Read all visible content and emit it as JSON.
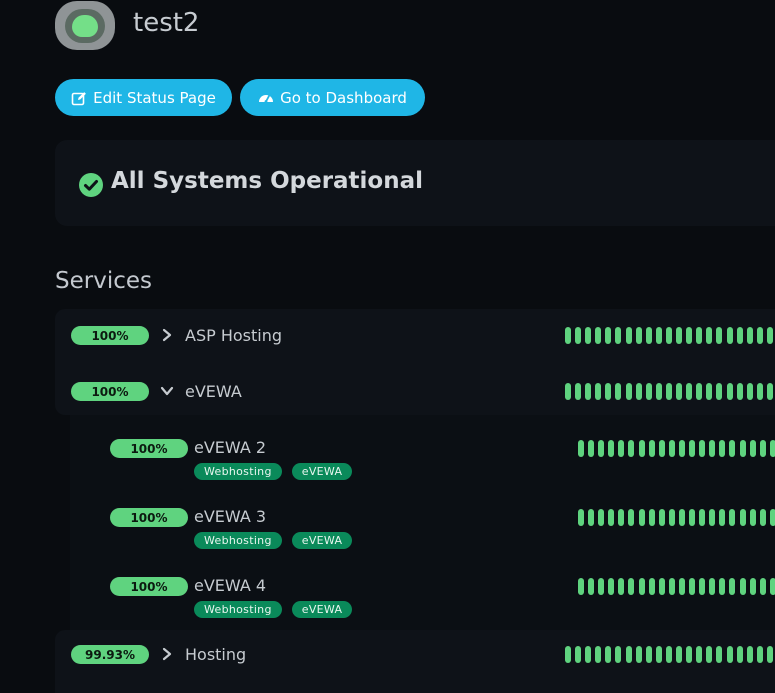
{
  "header": {
    "title": "test2"
  },
  "toolbar": {
    "edit_label": "Edit Status Page",
    "dashboard_label": "Go to Dashboard"
  },
  "overall": {
    "text": "All Systems Operational"
  },
  "services": {
    "title": "Services",
    "groups": [
      {
        "name": "ASP Hosting",
        "uptime": "100%"
      },
      {
        "name": "eVEWA",
        "uptime": "100%"
      },
      {
        "name": "Hosting",
        "uptime": "99.93%"
      }
    ],
    "children": [
      {
        "name": "eVEWA 2",
        "uptime": "100%",
        "tags": [
          "Webhosting",
          "eVEWA"
        ]
      },
      {
        "name": "eVEWA 3",
        "uptime": "100%",
        "tags": [
          "Webhosting",
          "eVEWA"
        ]
      },
      {
        "name": "eVEWA 4",
        "uptime": "100%",
        "tags": [
          "Webhosting",
          "eVEWA"
        ]
      }
    ]
  },
  "colors": {
    "accent": "#1fb6e6",
    "up": "#5fd37f",
    "tag": "#0a8a5a",
    "background": "#090c10",
    "panel": "#0e1218"
  }
}
